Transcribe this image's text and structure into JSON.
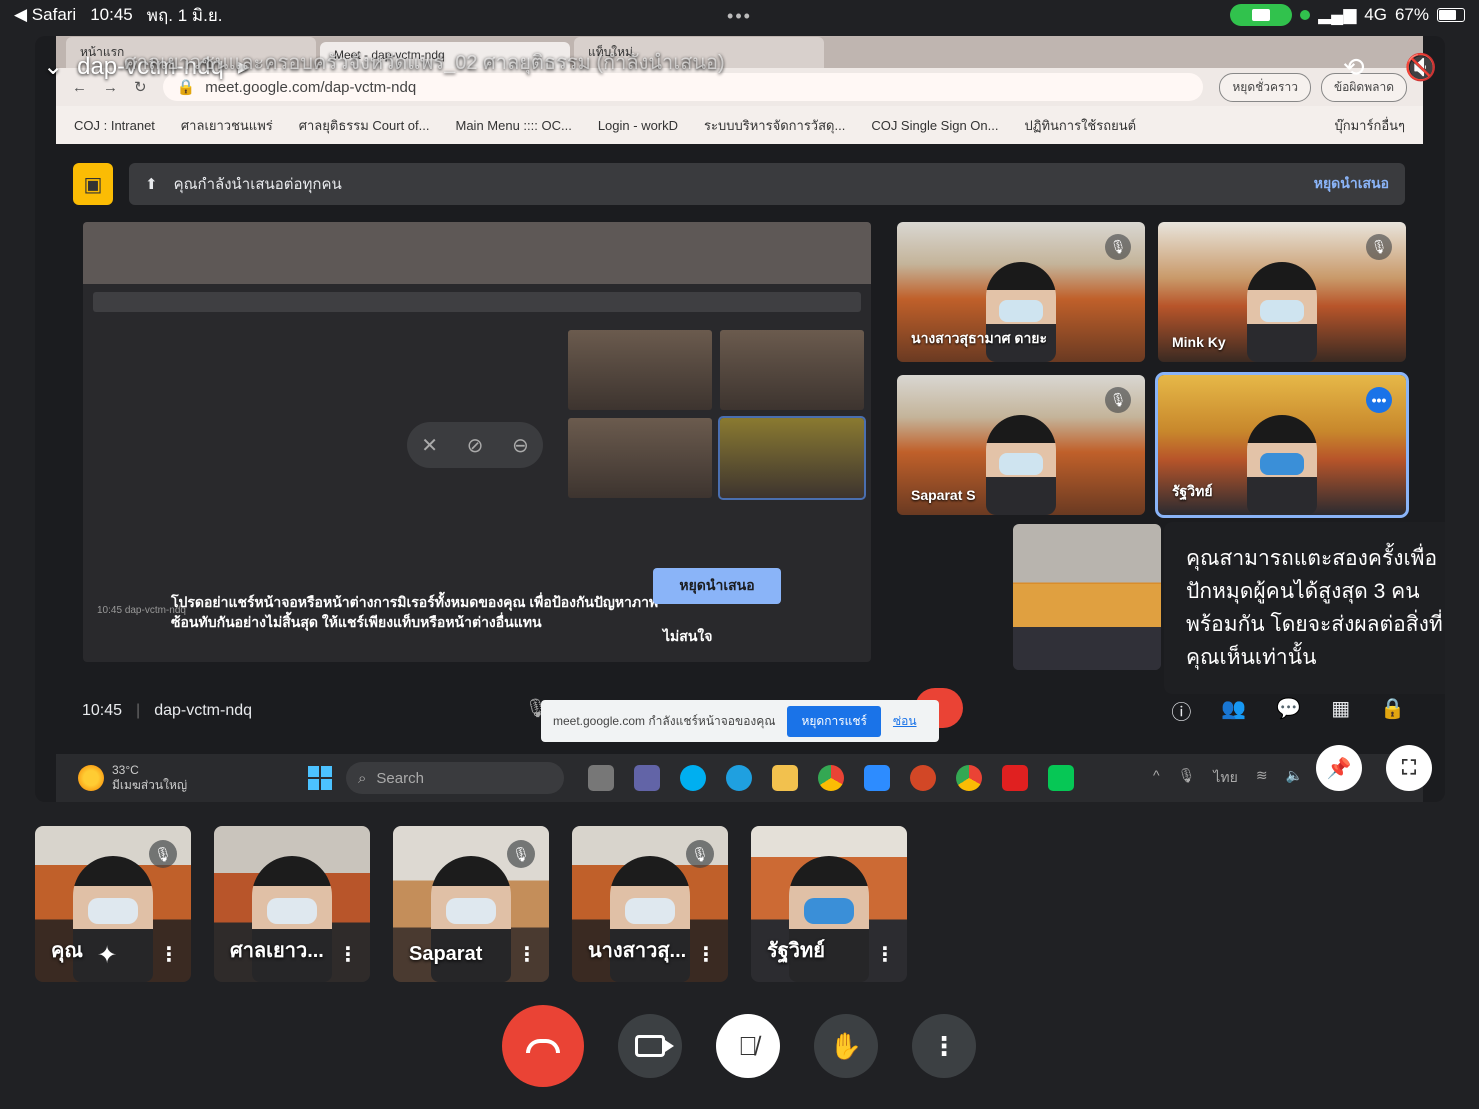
{
  "status_bar": {
    "back_app": "◀ Safari",
    "time": "10:45",
    "date": "พฤ. 1 มิ.ย.",
    "dots": "•••",
    "network": "4G",
    "battery": "67%"
  },
  "meeting": {
    "code": "dap-vctm-ndq",
    "ghost_title": "ศาลเยาวชนและครอบครัวจังหวัดแพร่_02 ศาลยุติธรรม (กำลังนำเสนอ)"
  },
  "browser": {
    "tabs": [
      "หน้าแรก",
      "Meet - dap-vctm-ndq",
      "แท็บใหม่"
    ],
    "url": "meet.google.com/dap-vctm-ndq",
    "pill_pause": "หยุดชั่วคราว",
    "pill_error": "ข้อผิดพลาด",
    "bookmarks": [
      "COJ : Intranet",
      "ศาลเยาวชนแพร่",
      "ศาลยุติธรรม Court of...",
      "Main Menu :::: OC...",
      "Login - workD",
      "ระบบบริหารจัดการวัสดุ...",
      "COJ Single Sign On...",
      "ปฏิทินการใช้รถยนต์",
      "บุ๊กมาร์กอื่นๆ"
    ]
  },
  "presenting_bar": {
    "text": "คุณกำลังนำเสนอต่อทุกคน",
    "stop_label": "หยุดนำเสนอ"
  },
  "mini_screen": {
    "warning": "โปรดอย่าแชร์หน้าจอหรือหน้าต่างการมิเรอร์ทั้งหมดของคุณ เพื่อป้องกันปัญหาภาพซ้อนทับกันอย่างไม่สิ้นสุด ให้แชร์เพียงแท็บหรือหน้าต่างอื่นแทน",
    "stop_button": "หยุดนำเสนอ",
    "ignore": "ไม่สนใจ",
    "time": "10:45",
    "code": "dap-vctm-ndq"
  },
  "grid_participants": [
    {
      "name": "นางสาวสุธามาศ ดายะ",
      "muted": true
    },
    {
      "name": "Mink Ky",
      "muted": true
    },
    {
      "name": "Saparat S",
      "muted": true
    },
    {
      "name": "รัฐวิทย์",
      "muted": false
    }
  ],
  "tooltip": "คุณสามารถแตะสองครั้งเพื่อปักหมุดผู้คนได้สูงสุด 3 คนพร้อมกัน โดยจะส่งผลต่อสิ่งที่คุณเห็นเท่านั้น",
  "meet_bottom": {
    "time": "10:45",
    "code": "dap-vctm-ndq"
  },
  "share_note": {
    "text": "meet.google.com กำลังแชร์หน้าจอของคุณ",
    "stop_btn": "หยุดการแชร์",
    "hide": "ซ่อน"
  },
  "taskbar": {
    "temp": "33°C",
    "weather": "มีเมฆส่วนใหญ่",
    "search": "Search",
    "lang": "ไทย"
  },
  "strip_participants": [
    {
      "name": "คุณ",
      "muted": true
    },
    {
      "name": "ศาลเยาว...",
      "muted": false
    },
    {
      "name": "Saparat",
      "muted": true
    },
    {
      "name": "นางสาวสุ...",
      "muted": true
    },
    {
      "name": "รัฐวิทย์",
      "muted": false
    }
  ],
  "colors": {
    "end_call": "#ea4335",
    "accent": "#8ab4f8",
    "camera_indicator": "#31c24d",
    "presenting_icon": "#fbbc04"
  }
}
